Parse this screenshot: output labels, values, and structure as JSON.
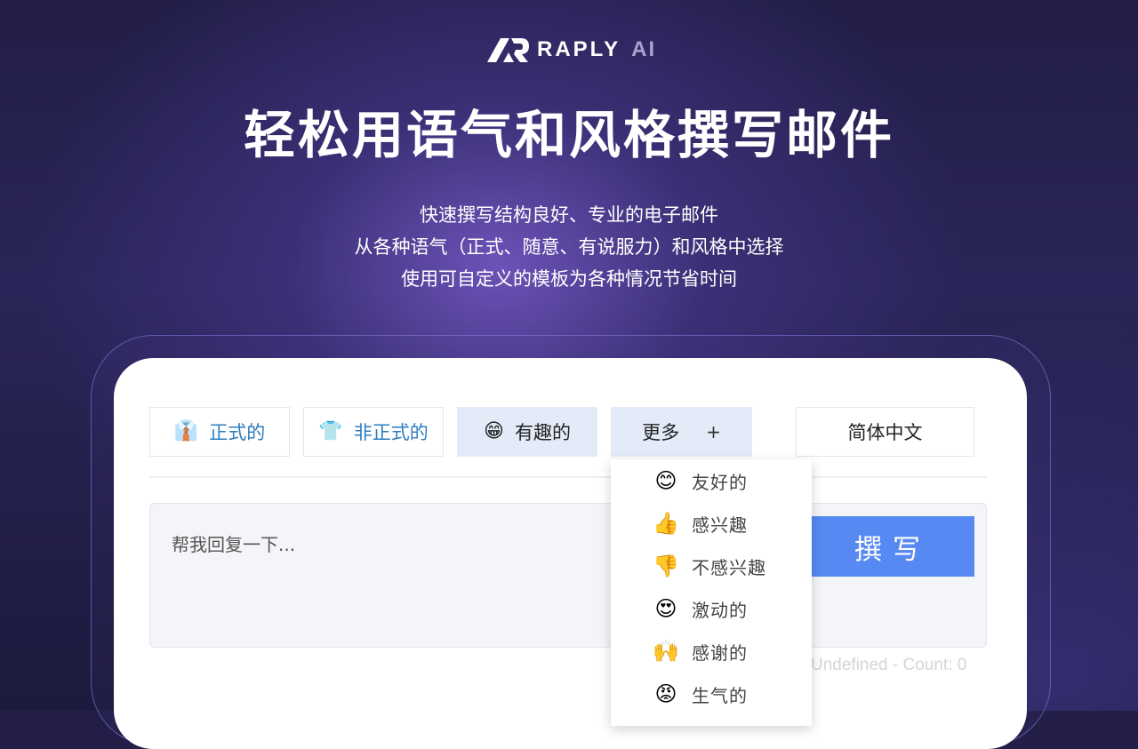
{
  "brand": {
    "name": "RAPLY",
    "suffix": "AI"
  },
  "headline": "轻松用语气和风格撰写邮件",
  "subtitles": [
    "快速撰写结构良好、专业的电子邮件",
    "从各种语气（正式、随意、有说服力）和风格中选择",
    "使用可自定义的模板为各种情况节省时间"
  ],
  "tones": {
    "formal": {
      "label": "正式的",
      "icon": "👔"
    },
    "informal": {
      "label": "非正式的",
      "icon": "👕"
    },
    "fun": {
      "label": "有趣的",
      "icon": "😁"
    },
    "more": {
      "label": "更多",
      "icon": "+"
    }
  },
  "language": "简体中文",
  "prompt_placeholder": "帮我回复一下...",
  "write_button": "撰写",
  "counter": "Undefined - Count: 0",
  "more_menu": [
    {
      "label": "友好的",
      "icon": "😊"
    },
    {
      "label": "感兴趣",
      "icon": "👍"
    },
    {
      "label": "不感兴趣",
      "icon": "👎"
    },
    {
      "label": "激动的",
      "icon": "😍"
    },
    {
      "label": "感谢的",
      "icon": "🙌"
    },
    {
      "label": "生气的",
      "icon": "😡"
    }
  ],
  "colors": {
    "accent": "#5789f2",
    "selected_bg": "#e3ebf8",
    "link": "#2d7cc0"
  }
}
